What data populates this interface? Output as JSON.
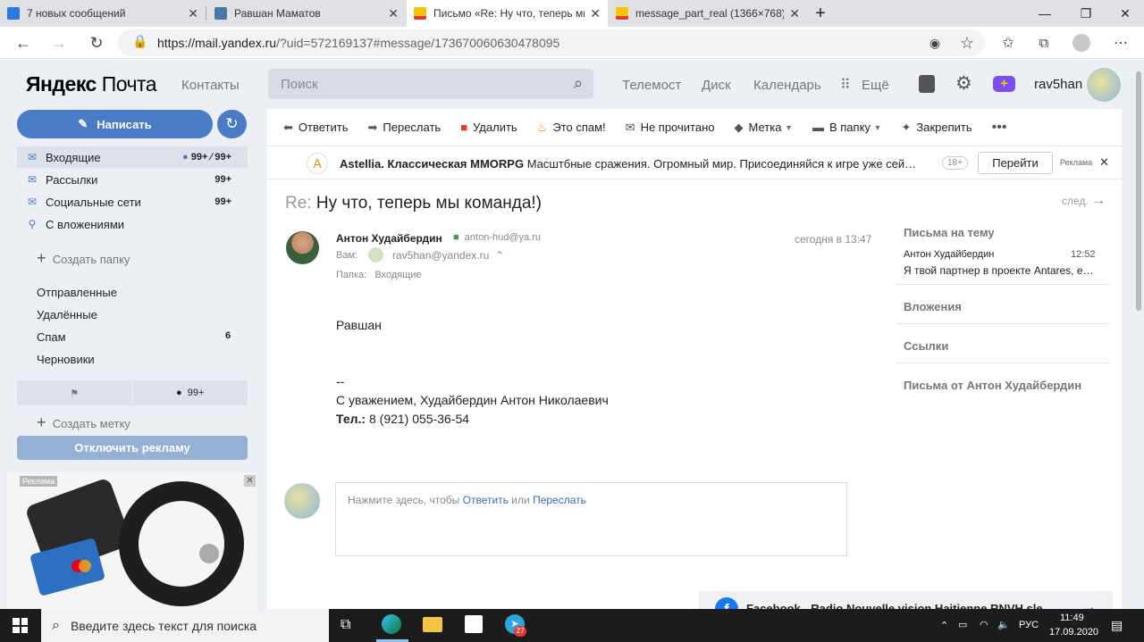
{
  "browser": {
    "tabs": [
      {
        "title": "7 новых сообщений",
        "favicon_color": "#2a7ae2"
      },
      {
        "title": "Равшан Маматов",
        "favicon_color": "#4a76a8"
      },
      {
        "title": "Письмо «Re: Ну что, теперь мы",
        "favicon_color": "#f5c400"
      },
      {
        "title": "message_part_real (1366×768)",
        "favicon_color": "#e64a19"
      }
    ],
    "url_host": "https://mail.yandex.ru",
    "url_path": "/?uid=572169137#message/173670060630478095"
  },
  "header": {
    "logo_main": "Яндекс",
    "logo_sub": "Почта",
    "contacts": "Контакты",
    "search_placeholder": "Поиск",
    "nav": [
      "Телемост",
      "Диск",
      "Календарь",
      "Ещё"
    ],
    "user": "rav5han"
  },
  "sidebar": {
    "compose": "Написать",
    "folders": [
      {
        "label": "Входящие",
        "count": "99+ ⁄ 99+",
        "icon": "inbox-icon"
      },
      {
        "label": "Рассылки",
        "count": "99+",
        "icon": "newsletters-icon"
      },
      {
        "label": "Социальные сети",
        "count": "99+",
        "icon": "social-icon"
      },
      {
        "label": "С вложениями",
        "count": "",
        "icon": "paperclip-icon"
      }
    ],
    "create_folder": "Создать папку",
    "folders2": [
      {
        "label": "Отправленные",
        "count": ""
      },
      {
        "label": "Удалённые",
        "count": ""
      },
      {
        "label": "Спам",
        "count": "6"
      },
      {
        "label": "Черновики",
        "count": ""
      }
    ],
    "labels_count": "99+",
    "create_label": "Создать метку",
    "disable_ads": "Отключить рекламу",
    "ad_tag": "Реклама"
  },
  "toolbar": {
    "items": [
      {
        "label": "Ответить",
        "icon": "reply-icon"
      },
      {
        "label": "Переслать",
        "icon": "forward-icon"
      },
      {
        "label": "Удалить",
        "icon": "trash-icon"
      },
      {
        "label": "Это спам!",
        "icon": "fire-icon"
      },
      {
        "label": "Не прочитано",
        "icon": "envelope-icon"
      },
      {
        "label": "Метка",
        "icon": "tag-icon"
      },
      {
        "label": "В папку",
        "icon": "folder-icon"
      },
      {
        "label": "Закрепить",
        "icon": "pin-icon"
      }
    ]
  },
  "adbar": {
    "title": "Astellia. Классическая MMORPG",
    "text": "Масштбные сражения. Огромный мир. Присоединяйся к игре уже сей…",
    "age": "18+",
    "button": "Перейти",
    "tag": "Реклама"
  },
  "message": {
    "subject_prefix": "Re:",
    "subject": "Ну что, теперь мы команда!)",
    "next": "след.",
    "sender": "Антон Худайбердин",
    "sender_email": "anton-hud@ya.ru",
    "date": "сегодня в 13:47",
    "to_label": "Вам:",
    "to_email": "rav5han@yandex.ru",
    "folder_label": "Папка:",
    "folder": "Входящие",
    "greeting": "Равшан",
    "sig_dash": "--",
    "sig_line": "С уважением, Худайбердин Антон Николаевич",
    "phone_label": "Тел.:",
    "phone": "8 (921) 055-36-54",
    "reply_prefix": "Нажмите здесь, чтобы",
    "reply_link": "Ответить",
    "reply_or": "или",
    "forward_link": "Переслать"
  },
  "right_panel": {
    "thread_title": "Письма на тему",
    "thread_sender": "Антон Худайбердин",
    "thread_time": "12:52",
    "thread_snippet": "Я твой партнер в проекте Antares, е…",
    "attachments": "Вложения",
    "links": "Ссылки",
    "from_sender": "Письма от Антон Худайбердин"
  },
  "social_bar": "Facebook - Radio Nouvelle vision Haitienne RNVH sle",
  "taskbar": {
    "search_placeholder": "Введите здесь текст для поиска",
    "lang": "РУС",
    "time": "11:49",
    "date": "17.09.2020",
    "telegram_badge": "27"
  },
  "colors": {
    "accent": "#4a7bc6",
    "page_bg": "#eceff4"
  }
}
